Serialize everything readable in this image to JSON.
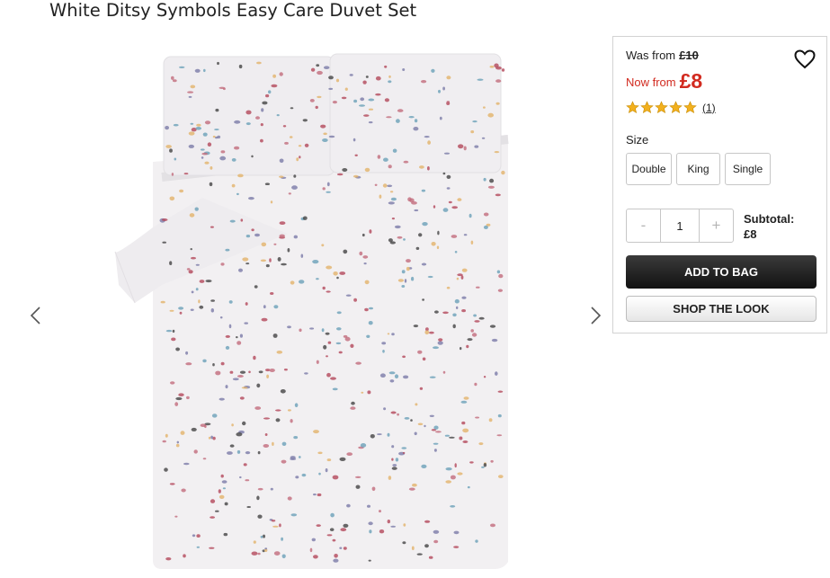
{
  "product": {
    "title": "White Ditsy Symbols Easy Care Duvet Set"
  },
  "gallery": {
    "prev_icon": "chevron-left-icon",
    "next_icon": "chevron-right-icon",
    "image_icon": "product-image-duvet-set"
  },
  "pricing": {
    "was_label": "Was from",
    "was_price": "£10",
    "now_label": "Now from",
    "now_price": "£8"
  },
  "wishlist": {
    "icon": "heart-icon"
  },
  "rating": {
    "stars": 5,
    "max": 5,
    "review_count": "(1)",
    "star_color": "#f2b01e"
  },
  "size": {
    "label": "Size",
    "options": [
      "Double",
      "King",
      "Single"
    ]
  },
  "quantity": {
    "decrement_label": "-",
    "value": "1",
    "increment_label": "+"
  },
  "subtotal": {
    "label": "Subtotal:",
    "value": "£8"
  },
  "actions": {
    "add_to_bag": "ADD TO BAG",
    "shop_the_look": "SHOP THE LOOK"
  },
  "colors": {
    "sale_red": "#d22b20",
    "button_dark": "#1a1a1a"
  }
}
